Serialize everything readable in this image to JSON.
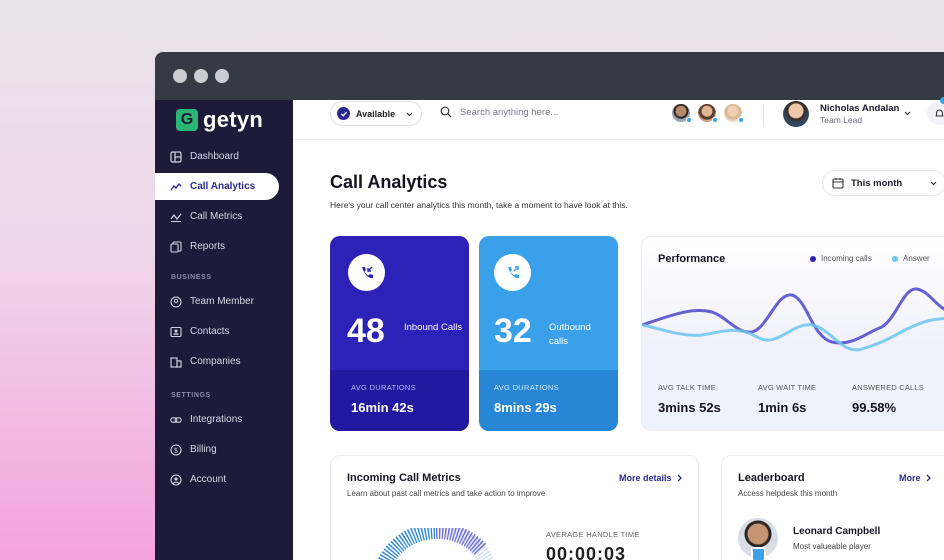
{
  "app": {
    "logo_text": "getyn",
    "logo_mark": "G"
  },
  "sidebar": {
    "items": [
      {
        "label": "Dashboard",
        "icon": "dashboard-icon"
      },
      {
        "label": "Call Analytics",
        "icon": "analytics-icon",
        "active": true
      },
      {
        "label": "Call Metrics",
        "icon": "metrics-icon"
      },
      {
        "label": "Reports",
        "icon": "reports-icon"
      }
    ],
    "section_business": "BUSINESS",
    "business_items": [
      {
        "label": "Team Member",
        "icon": "team-icon"
      },
      {
        "label": "Contacts",
        "icon": "contacts-icon"
      },
      {
        "label": "Companies",
        "icon": "companies-icon"
      }
    ],
    "section_settings": "SETTINGS",
    "settings_items": [
      {
        "label": "Integrations",
        "icon": "link-icon"
      },
      {
        "label": "Billing",
        "icon": "dollar-icon"
      },
      {
        "label": "Account",
        "icon": "user-icon"
      }
    ]
  },
  "topbar": {
    "status": "Available",
    "search_placeholder": "Search anything here...",
    "user_name": "Nicholas Andalan",
    "user_role": "Team Lead"
  },
  "header": {
    "title": "Call Analytics",
    "subtitle": "Here's your call center analytics this month, take a moment to have look at this.",
    "period": "This month"
  },
  "cards": {
    "inbound": {
      "value": "48",
      "label": "Inbound Calls",
      "foot_label": "AVG DURATIONS",
      "foot_value": "16min 42s"
    },
    "outbound": {
      "value": "32",
      "label": "Outbound calls",
      "foot_label": "AVG DURATIONS",
      "foot_value": "8mins 29s"
    }
  },
  "performance": {
    "title": "Performance",
    "legend": [
      {
        "name": "Incoming calls",
        "color": "#2c22b8"
      },
      {
        "name": "Answer",
        "color": "#6cc6ee"
      }
    ],
    "stats": [
      {
        "label": "AVG TALK TIME",
        "value": "3mins 52s"
      },
      {
        "label": "AVG WAIT TIME",
        "value": "1min 6s"
      },
      {
        "label": "ANSWERED CALLS",
        "value": "99.58%"
      }
    ]
  },
  "incoming_metrics": {
    "title": "Incoming Call Metrics",
    "subtitle": "Learn about past call metrics and take action to improve",
    "link": "More details",
    "aht_label": "AVERAGE HANDLE TIME",
    "aht_value": "00:00:03"
  },
  "leaderboard": {
    "title": "Leaderboard",
    "subtitle": "Access helpdesk this month",
    "link": "More",
    "leader_name": "Leonard Campbell",
    "leader_role": "Most valueable player"
  },
  "colors": {
    "primary": "#2c22b8",
    "accent": "#3aa0ea",
    "sidebar": "#1e1b3a"
  }
}
